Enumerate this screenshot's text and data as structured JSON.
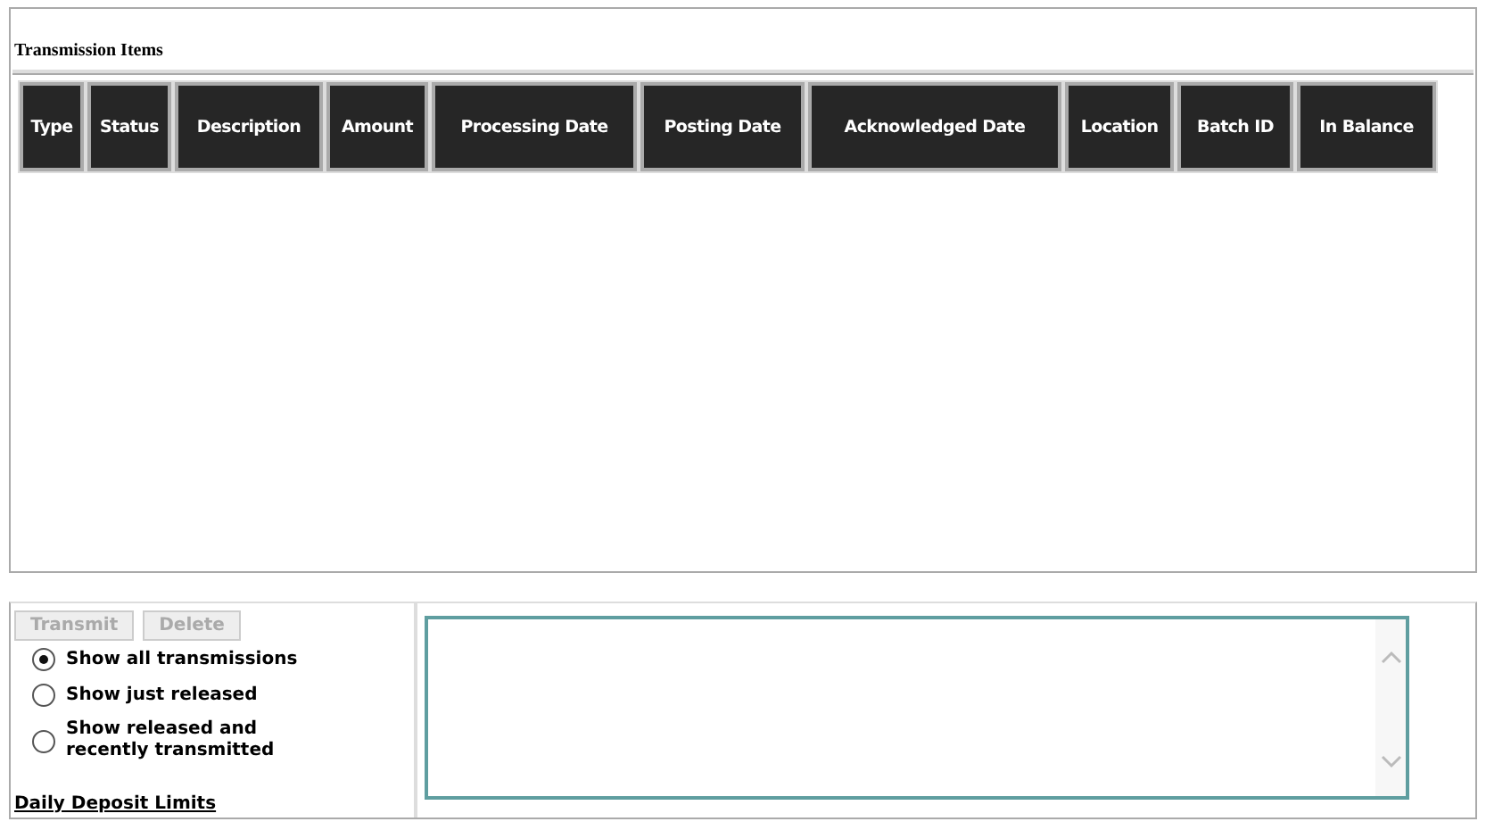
{
  "section_title": "Transmission Items",
  "table": {
    "columns": [
      "Type",
      "Status",
      "Description",
      "Amount",
      "Processing Date",
      "Posting Date",
      "Acknowledged Date",
      "Location",
      "Batch ID",
      "In Balance"
    ]
  },
  "buttons": [
    {
      "label": "Transmit",
      "disabled": true
    },
    {
      "label": "Delete",
      "disabled": true
    }
  ],
  "filters": [
    {
      "label": "Show all transmissions",
      "selected": true
    },
    {
      "label": "Show just released",
      "selected": false
    },
    {
      "label": "Show released and recently transmitted",
      "selected": false
    }
  ],
  "link": "Daily Deposit Limits"
}
